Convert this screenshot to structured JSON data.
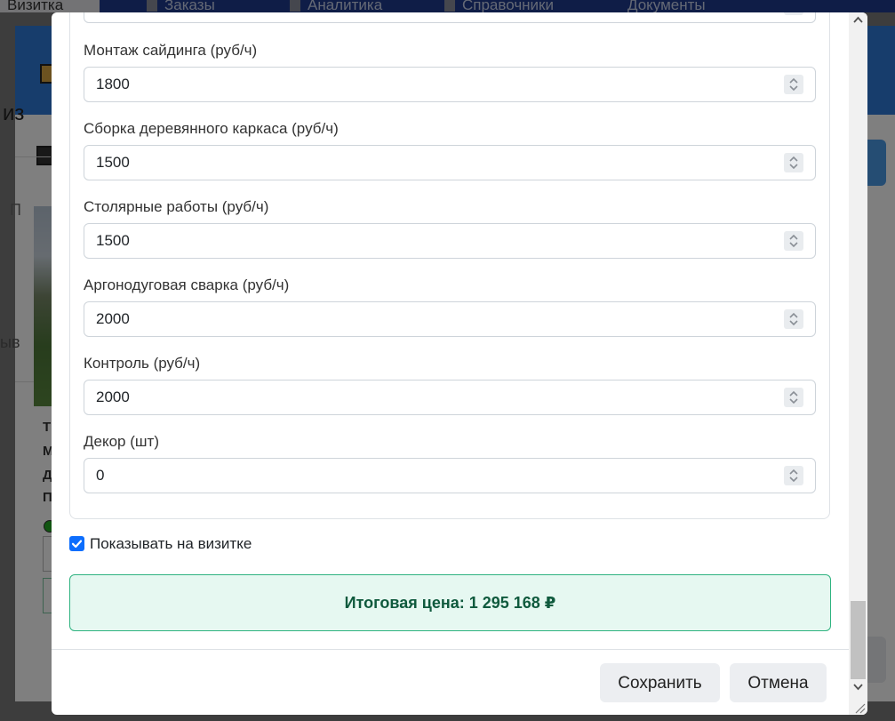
{
  "background": {
    "nav": [
      {
        "label": "Визитка"
      },
      {
        "label": "Заказы"
      },
      {
        "label": "Аналитика"
      },
      {
        "label": "Справочники"
      },
      {
        "label": "Документы"
      }
    ],
    "fragments": {
      "f1": "из",
      "f2": "П",
      "f3": "ыв",
      "f4": "Т",
      "f5": "М",
      "f6": "Д",
      "f7": "П"
    }
  },
  "form": {
    "fields": [
      {
        "label": "Монтаж сайдинга (руб/ч)",
        "value": "1800"
      },
      {
        "label": "Сборка деревянного каркаса (руб/ч)",
        "value": "1500"
      },
      {
        "label": "Столярные работы (руб/ч)",
        "value": "1500"
      },
      {
        "label": "Аргонодуговая сварка (руб/ч)",
        "value": "2000"
      },
      {
        "label": "Контроль (руб/ч)",
        "value": "2000"
      },
      {
        "label": "Декор (шт)",
        "value": "0"
      }
    ],
    "show_on_card": {
      "label": "Показывать на визитке",
      "checked": true
    },
    "total": "Итоговая цена: 1 295 168 ₽",
    "save_label": "Сохранить",
    "cancel_label": "Отмена"
  },
  "colors": {
    "accent": "#0d6efd",
    "total_bg": "#e6f8f1",
    "total_border": "#2fb380",
    "total_text": "#0f5a3d",
    "nav_bg": "#1f3a8f",
    "panel_header": "#2f7bd9"
  }
}
